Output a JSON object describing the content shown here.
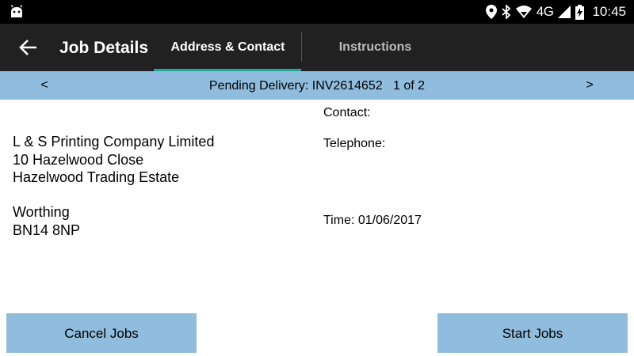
{
  "status_bar": {
    "network": "4G",
    "time": "10:45",
    "icons": [
      "android-icon",
      "location-icon",
      "bluetooth-icon",
      "wifi-icon",
      "signal-icon",
      "battery-charging-icon"
    ]
  },
  "app_bar": {
    "title": "Job Details",
    "back_icon": "arrow-back-icon",
    "tabs": [
      {
        "label": "Address & Contact",
        "selected": true
      },
      {
        "label": "Instructions",
        "selected": false
      }
    ],
    "accent_color": "#26a69a",
    "background": "#212121"
  },
  "nav": {
    "prev": "<",
    "next": ">",
    "text": "Pending Delivery: INV2614652   1 of 2",
    "background": "#90bcdd"
  },
  "address": {
    "lines": [
      "L & S Printing Company Limited",
      "10 Hazelwood Close",
      "Hazelwood Trading Estate"
    ],
    "city": "Worthing",
    "postcode": "BN14 8NP"
  },
  "details": {
    "contact": "Contact:",
    "telephone": "Telephone:",
    "time": "Time: 01/06/2017"
  },
  "buttons": {
    "cancel": "Cancel Jobs",
    "start": "Start Jobs",
    "background": "#90bcdd"
  }
}
